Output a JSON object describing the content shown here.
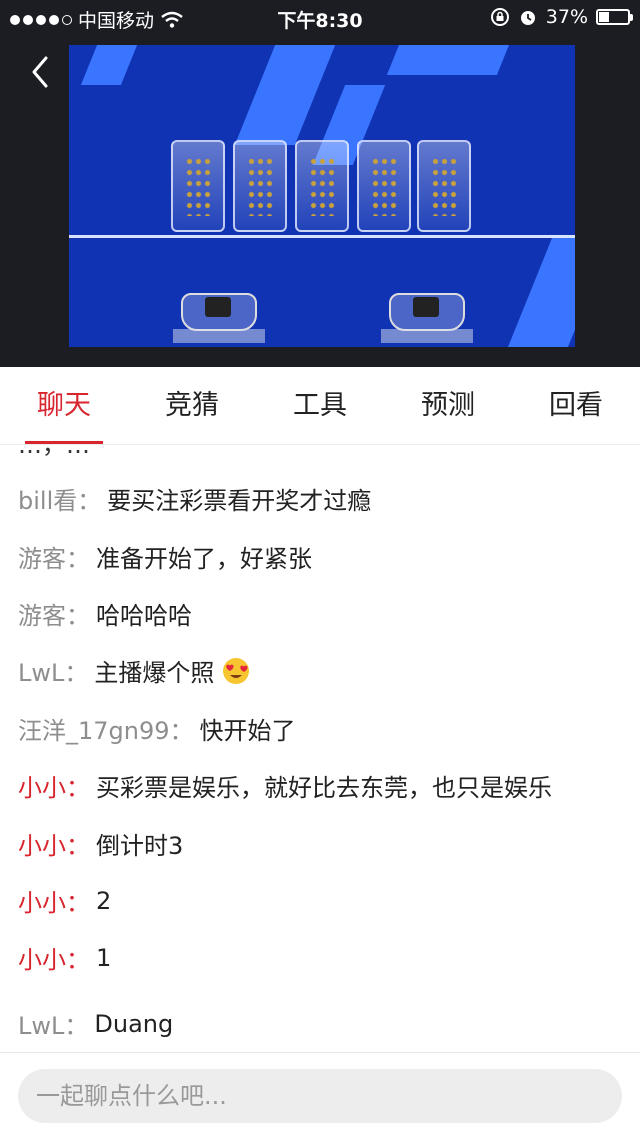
{
  "status_bar": {
    "carrier": "中国移动",
    "time": "下午8:30",
    "battery": "37%",
    "battery_level": 0.37
  },
  "tabs": [
    {
      "label": "聊天",
      "active": true
    },
    {
      "label": "竞猜",
      "active": false
    },
    {
      "label": "工具",
      "active": false
    },
    {
      "label": "预测",
      "active": false
    },
    {
      "label": "回看",
      "active": false
    }
  ],
  "chat": {
    "cut_off_text": "…，…",
    "messages": [
      {
        "user": "bill看：",
        "text": "要买注彩票看开奖才过瘾",
        "highlight": false
      },
      {
        "user": "游客：",
        "text": "准备开始了，好紧张",
        "highlight": false
      },
      {
        "user": "游客：",
        "text": "哈哈哈哈",
        "highlight": false
      },
      {
        "user": "LwL：",
        "text": "主播爆个照",
        "highlight": false,
        "emoji": "heart-eyes"
      },
      {
        "user": "汪洋_17gn99：",
        "text": "快开始了",
        "highlight": false
      },
      {
        "user": "小小：",
        "text": "买彩票是娱乐，就好比去东莞，也只是娱乐",
        "highlight": true
      },
      {
        "user": "小小：",
        "text": "倒计时3",
        "highlight": true
      },
      {
        "user": "小小：",
        "text": "2",
        "highlight": true
      },
      {
        "user": "小小：",
        "text": "1",
        "highlight": true
      },
      {
        "user": "LwL：",
        "text": "Duang",
        "highlight": false
      }
    ]
  },
  "input": {
    "placeholder": "一起聊点什么吧...",
    "value": ""
  },
  "colors": {
    "accent": "#d8262f",
    "username": "#8e8e8e",
    "video_bg": "#1033b4"
  }
}
